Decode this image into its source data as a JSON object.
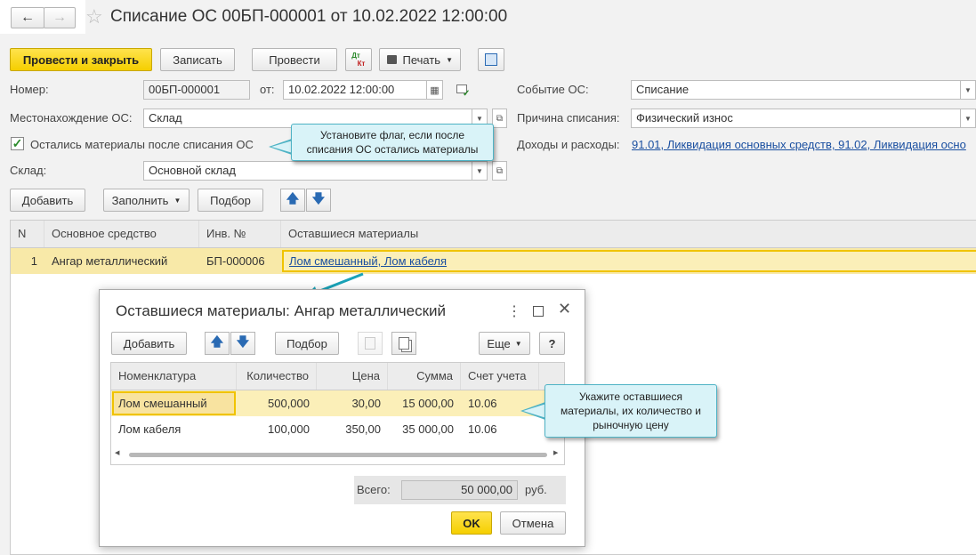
{
  "window": {
    "title": "Списание ОС 00БП-000001 от 10.02.2022 12:00:00"
  },
  "toolbar": {
    "post_close": "Провести и закрыть",
    "save": "Записать",
    "post": "Провести",
    "dt_kt_top": "Дт",
    "dt_kt_bottom": "Кт",
    "print": "Печать"
  },
  "form": {
    "number_label": "Номер:",
    "number_value": "00БП-000001",
    "date_label": "от:",
    "date_value": "10.02.2022 12:00:00",
    "event_label": "Событие ОС:",
    "event_value": "Списание",
    "location_label": "Местонахождение ОС:",
    "location_value": "Склад",
    "reason_label": "Причина списания:",
    "reason_value": "Физический износ",
    "materials_checkbox_label": "Остались материалы после списания ОС",
    "income_label": "Доходы и расходы:",
    "income_value": "91.01, Ликвидация основных средств, 91.02, Ликвидация осно",
    "warehouse_label": "Склад:",
    "warehouse_value": "Основной склад"
  },
  "table_toolbar": {
    "add": "Добавить",
    "fill": "Заполнить",
    "select": "Подбор"
  },
  "table": {
    "headers": [
      "N",
      "Основное средство",
      "Инв. №",
      "Оставшиеся материалы"
    ],
    "rows": [
      {
        "n": "1",
        "asset": "Ангар металлический",
        "inv": "БП-000006",
        "materials": "Лом смешанный, Лом кабеля"
      }
    ]
  },
  "callout_top": {
    "text": "Установите флаг, если после списания ОС остались материалы"
  },
  "dialog": {
    "title": "Оставшиеся материалы: Ангар металлический",
    "add": "Добавить",
    "select": "Подбор",
    "more": "Еще",
    "help": "?",
    "headers": [
      "Номенклатура",
      "Количество",
      "Цена",
      "Сумма",
      "Счет учета"
    ],
    "rows": [
      {
        "item": "Лом смешанный",
        "qty": "500,000",
        "price": "30,00",
        "sum": "15 000,00",
        "account": "10.06"
      },
      {
        "item": "Лом кабеля",
        "qty": "100,000",
        "price": "350,00",
        "sum": "35 000,00",
        "account": "10.06"
      }
    ],
    "total_label": "Всего:",
    "total_value": "50 000,00",
    "currency": "руб.",
    "ok": "OK",
    "cancel": "Отмена"
  },
  "callout_dialog": {
    "text": "Укажите оставшиеся материалы, их количество и рыночную цену"
  },
  "colors": {
    "accent_yellow": "#f5cf00",
    "selected_row": "#f8e9a8",
    "callout_bg": "#d9f3f8",
    "callout_border": "#4fb3c5",
    "link": "#1a4fa0"
  }
}
